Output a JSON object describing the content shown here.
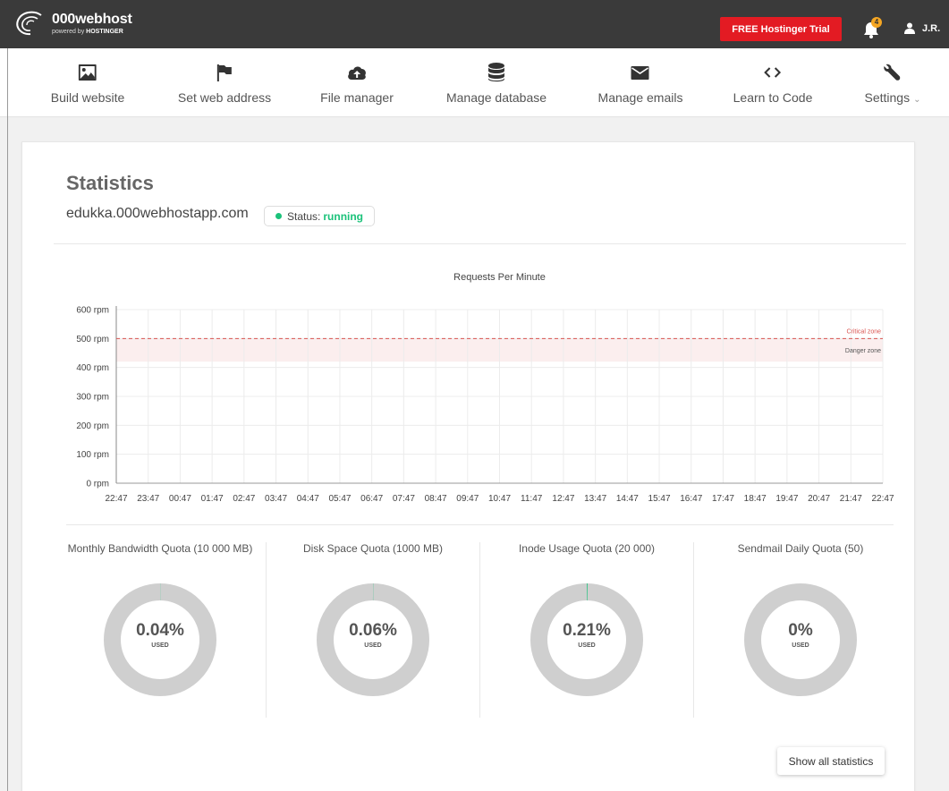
{
  "header": {
    "logo_name": "000webhost",
    "logo_sub_prefix": "powered by",
    "logo_sub_brand": "HOSTINGER",
    "trial_button": "FREE Hostinger Trial",
    "notification_count": "4",
    "user_initials": "J.R."
  },
  "nav": [
    {
      "label": "Build website",
      "icon": "image-icon"
    },
    {
      "label": "Set web address",
      "icon": "flag-icon"
    },
    {
      "label": "File manager",
      "icon": "cloud-upload-icon"
    },
    {
      "label": "Manage database",
      "icon": "database-icon"
    },
    {
      "label": "Manage emails",
      "icon": "envelope-icon"
    },
    {
      "label": "Learn to Code",
      "icon": "code-icon"
    },
    {
      "label": "Settings",
      "icon": "wrench-icon",
      "caret": "⌄"
    }
  ],
  "page": {
    "title": "Statistics",
    "domain": "edukka.000webhostapp.com",
    "status_label": "Status:",
    "status_value": "running"
  },
  "chart_data": {
    "type": "line",
    "title": "Requests Per Minute",
    "x": [
      "22:47",
      "23:47",
      "00:47",
      "01:47",
      "02:47",
      "03:47",
      "04:47",
      "05:47",
      "06:47",
      "07:47",
      "08:47",
      "09:47",
      "10:47",
      "11:47",
      "12:47",
      "13:47",
      "14:47",
      "15:47",
      "16:47",
      "17:47",
      "18:47",
      "19:47",
      "20:47",
      "21:47",
      "22:47"
    ],
    "y_ticks": [
      "0 rpm",
      "100 rpm",
      "200 rpm",
      "300 rpm",
      "400 rpm",
      "500 rpm",
      "600 rpm"
    ],
    "ylim": [
      0,
      600
    ],
    "series": [
      {
        "values": [
          0,
          0,
          0,
          0,
          0,
          0,
          0,
          0,
          0,
          0,
          0,
          0,
          0,
          0,
          0,
          0,
          0,
          0,
          0,
          0,
          0,
          0,
          0,
          0,
          0
        ]
      }
    ],
    "critical_line": 500,
    "danger_zone": [
      420,
      500
    ],
    "annotations": [
      "Critical zone",
      "Danger zone"
    ],
    "grid": true,
    "colors": {
      "critical": "#d9534f",
      "danger_fill": "#fbeeee",
      "grid": "#ececec",
      "axis": "#888"
    }
  },
  "quotas": [
    {
      "title": "Monthly Bandwidth Quota (10 000 MB)",
      "percent": "0.04%",
      "fraction": 0.0004,
      "used_label": "USED"
    },
    {
      "title": "Disk Space Quota (1000 MB)",
      "percent": "0.06%",
      "fraction": 0.0006,
      "used_label": "USED"
    },
    {
      "title": "Inode Usage Quota (20 000)",
      "percent": "0.21%",
      "fraction": 0.0021,
      "used_label": "USED"
    },
    {
      "title": "Sendmail Daily Quota (50)",
      "percent": "0%",
      "fraction": 0,
      "used_label": "USED"
    }
  ],
  "actions": {
    "show_all": "Show all statistics"
  },
  "colors": {
    "topbar": "#3a3a3a",
    "accent_red": "#e31b23",
    "status_green": "#1bc27a",
    "donut_gray": "#cfcfcf"
  }
}
